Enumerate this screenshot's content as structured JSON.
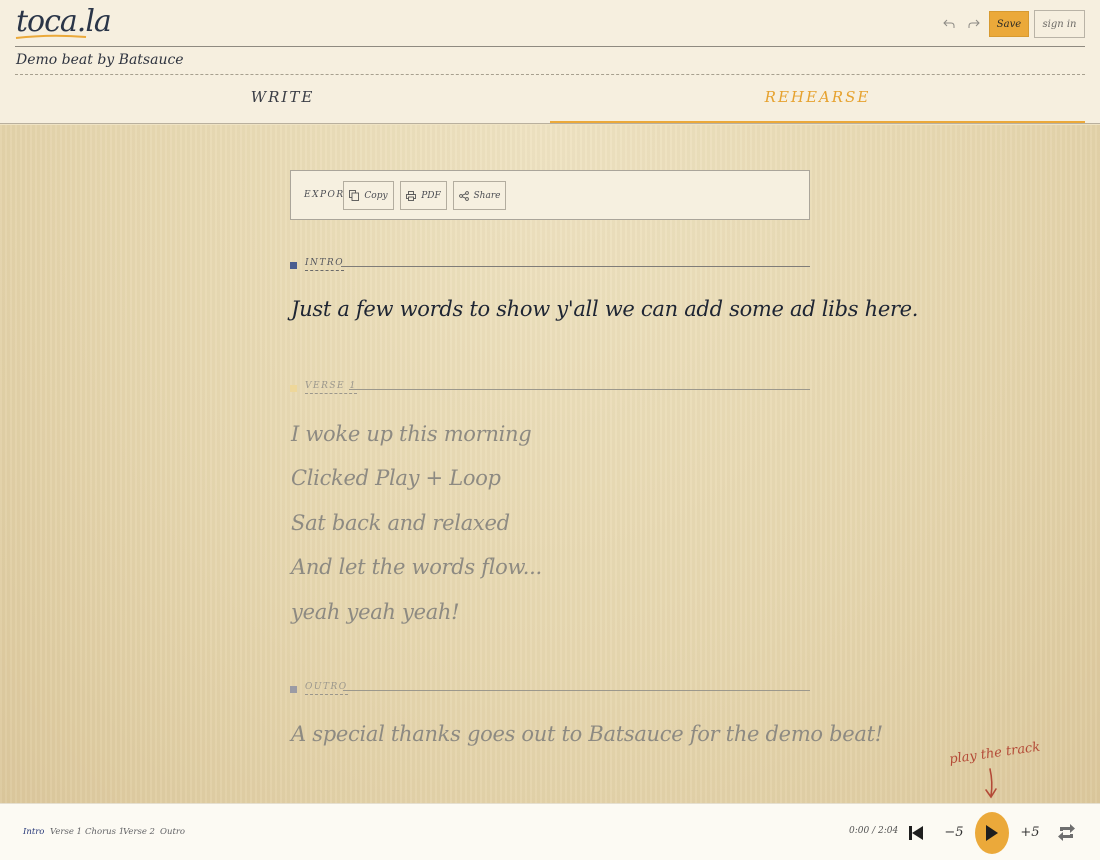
{
  "app": {
    "logo": "toca.la"
  },
  "header": {
    "song_title": "Demo beat by Batsauce",
    "save_label": "Save",
    "signin_label": "sign in",
    "accent_color": "#eba93a"
  },
  "tabs": [
    {
      "label": "WRITE",
      "active": false
    },
    {
      "label": "REHEARSE",
      "active": true
    }
  ],
  "export": {
    "label": "EXPORT",
    "buttons": [
      {
        "label": "Copy",
        "icon": "copy-icon"
      },
      {
        "label": "PDF",
        "icon": "printer-icon"
      },
      {
        "label": "Share",
        "icon": "share-icon"
      }
    ]
  },
  "sections": [
    {
      "label": "INTRO",
      "color": "#4a5d8f",
      "lines": [
        "Just a few words to show y'all we can add some ad libs here."
      ]
    },
    {
      "label": "VERSE 1",
      "color": "#eed79a",
      "lines": [
        "I woke up this morning",
        "Clicked Play + Loop",
        "Sat back and relaxed",
        "And let the words flow...",
        "yeah yeah yeah!"
      ]
    },
    {
      "label": "OUTRO",
      "color": "#9b9ba4",
      "lines": [
        "A special thanks goes out to Batsauce for the demo beat!"
      ]
    }
  ],
  "hint": {
    "text": "play the track"
  },
  "player": {
    "sections_nav": [
      "Intro",
      "Verse 1",
      "Chorus 1",
      "Verse 2",
      "Outro"
    ],
    "active_section": "Intro",
    "time": "0:00 / 2:04",
    "back_label": "−5",
    "forward_label": "+5"
  }
}
